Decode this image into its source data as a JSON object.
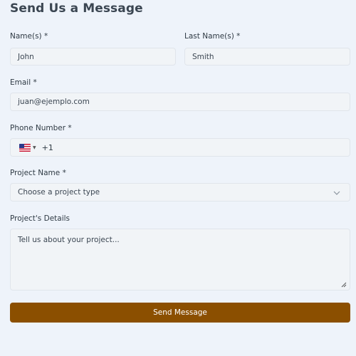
{
  "form": {
    "title": "Send Us a Message",
    "first_name": {
      "label": "Name(s) *",
      "value": "John"
    },
    "last_name": {
      "label": "Last Name(s) *",
      "value": "Smith"
    },
    "email": {
      "label": "Email *",
      "value": "juan@ejemplo.com"
    },
    "phone": {
      "label": "Phone Number *",
      "country_icon": "us-flag-icon",
      "dial_code": "+1"
    },
    "project_name": {
      "label": "Project Name *",
      "selected": "Choose a project type"
    },
    "project_details": {
      "label": "Project's Details",
      "placeholder": "Tell us about your project..."
    },
    "submit_label": "Send Message"
  },
  "colors": {
    "background": "#eef3fa",
    "field_background": "#f1f4f7",
    "field_border": "#e0e5eb",
    "button": "#8b4f00",
    "button_text": "#ffffff"
  }
}
